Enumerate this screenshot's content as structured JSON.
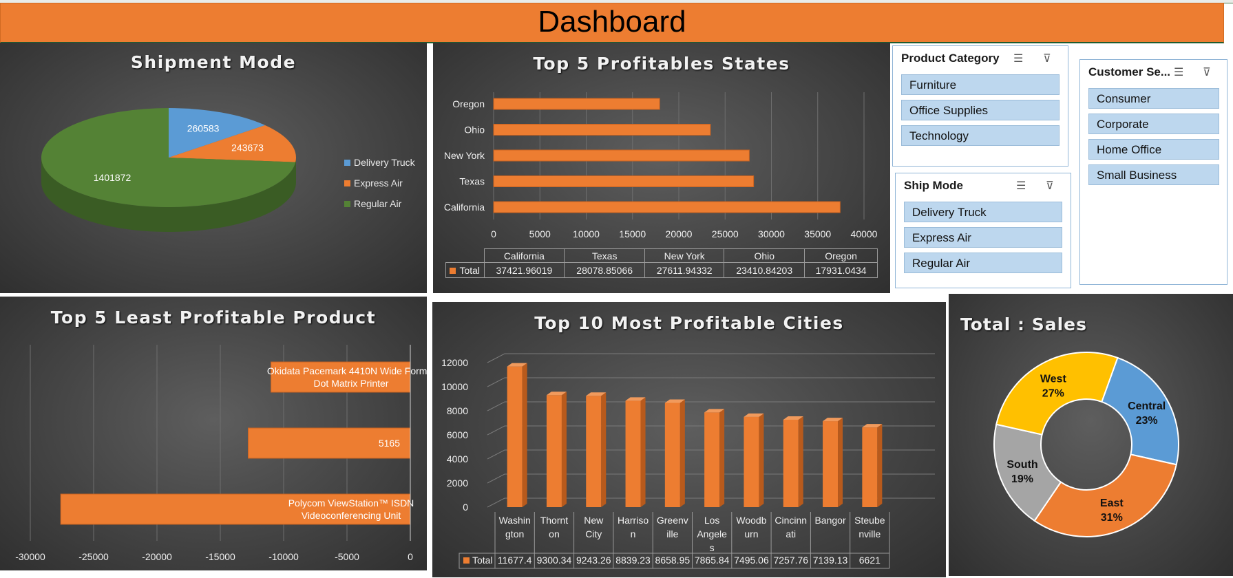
{
  "dashboard": {
    "title": "Dashboard"
  },
  "colors": {
    "orange": "#ED7D31",
    "blue": "#5B9BD5",
    "green": "#548235",
    "gold": "#FFC000",
    "gray": "#A5A5A5",
    "slicer_item": "#BDD7EE"
  },
  "slicers": {
    "product_category": {
      "title": "Product Category",
      "items": [
        "Furniture",
        "Office Supplies",
        "Technology"
      ]
    },
    "customer_segment": {
      "title": "Customer Se...",
      "items": [
        "Consumer",
        "Corporate",
        "Home Office",
        "Small Business"
      ]
    },
    "ship_mode": {
      "title": "Ship Mode",
      "items": [
        "Delivery Truck",
        "Express Air",
        "Regular Air"
      ]
    }
  },
  "chart_data": [
    {
      "id": "shipment-mode",
      "type": "pie",
      "title": "Shipment Mode",
      "labels": [
        "Delivery Truck",
        "Express Air",
        "Regular Air"
      ],
      "values": [
        260583,
        243673,
        1401872
      ],
      "data_labels": [
        "260583",
        "243673",
        "1401872"
      ],
      "colors": [
        "#5B9BD5",
        "#ED7D31",
        "#548235"
      ],
      "legend": "right"
    },
    {
      "id": "top-states",
      "type": "bar",
      "orientation": "horizontal",
      "title": "Top 5 Profitables States",
      "categories": [
        "California",
        "Texas",
        "New York",
        "Ohio",
        "Oregon"
      ],
      "series": [
        {
          "name": "Total",
          "values": [
            37421.96019,
            28078.85066,
            27611.94332,
            23410.84203,
            17931.0434
          ]
        }
      ],
      "table_values": [
        "37421.96019",
        "28078.85066",
        "27611.94332",
        "23410.84203",
        "17931.0434"
      ],
      "xlim": [
        0,
        40000
      ],
      "ticks": [
        "0",
        "5000",
        "10000",
        "15000",
        "20000",
        "25000",
        "30000",
        "35000",
        "40000"
      ],
      "grid": true
    },
    {
      "id": "least-products",
      "type": "bar",
      "orientation": "horizontal",
      "title": "Top 5 Least Profitable Product",
      "bars": [
        {
          "label": "Okidata Pacemark 4410N Wide Format Dot Matrix Printer",
          "value": -11000
        },
        {
          "label": "5165",
          "value": -12800
        },
        {
          "label": "Polycom ViewStation™ ISDN Videoconferencing Unit",
          "value": -27600
        }
      ],
      "xlim": [
        -30000,
        0
      ],
      "ticks": [
        "-30000",
        "-25000",
        "-20000",
        "-15000",
        "-10000",
        "-5000",
        "0"
      ],
      "grid": true
    },
    {
      "id": "top-cities",
      "type": "bar",
      "title": "Top 10 Most Profitable Cities",
      "categories": [
        "Washington",
        "Thornton",
        "New City",
        "Harrison",
        "Greenville",
        "Los Angeles",
        "Woodburn",
        "Cincinnati",
        "Bangor",
        "Steubenville"
      ],
      "category_lines": [
        [
          "Washin",
          "gton"
        ],
        [
          "Thornt",
          "on"
        ],
        [
          "New",
          "City"
        ],
        [
          "Harriso",
          "n"
        ],
        [
          "Greenv",
          "ille"
        ],
        [
          "Los",
          "Angele",
          "s"
        ],
        [
          "Woodb",
          "urn"
        ],
        [
          "Cincinn",
          "ati"
        ],
        [
          "Bangor"
        ],
        [
          "Steube",
          "nville"
        ]
      ],
      "series": [
        {
          "name": "Total",
          "values": [
            11677.4,
            9300.34,
            9243.26,
            8839.23,
            8658.95,
            7865.84,
            7495.06,
            7257.76,
            7139.13,
            6621
          ]
        }
      ],
      "table_values": [
        "11677.4",
        "9300.34",
        "9243.26",
        "8839.23",
        "8658.95",
        "7865.84",
        "7495.06",
        "7257.76",
        "7139.13",
        "6621"
      ],
      "ylim": [
        0,
        12000
      ],
      "ticks": [
        "0",
        "2000",
        "4000",
        "6000",
        "8000",
        "10000",
        "12000"
      ],
      "grid": true
    },
    {
      "id": "total-sales",
      "type": "pie",
      "style": "doughnut",
      "title": "Total : Sales",
      "labels": [
        "Central",
        "East",
        "South",
        "West"
      ],
      "values": [
        23,
        31,
        19,
        27
      ],
      "data_labels": [
        "23%",
        "31%",
        "19%",
        "27%"
      ],
      "colors": [
        "#5B9BD5",
        "#ED7D31",
        "#A5A5A5",
        "#FFC000"
      ]
    }
  ]
}
